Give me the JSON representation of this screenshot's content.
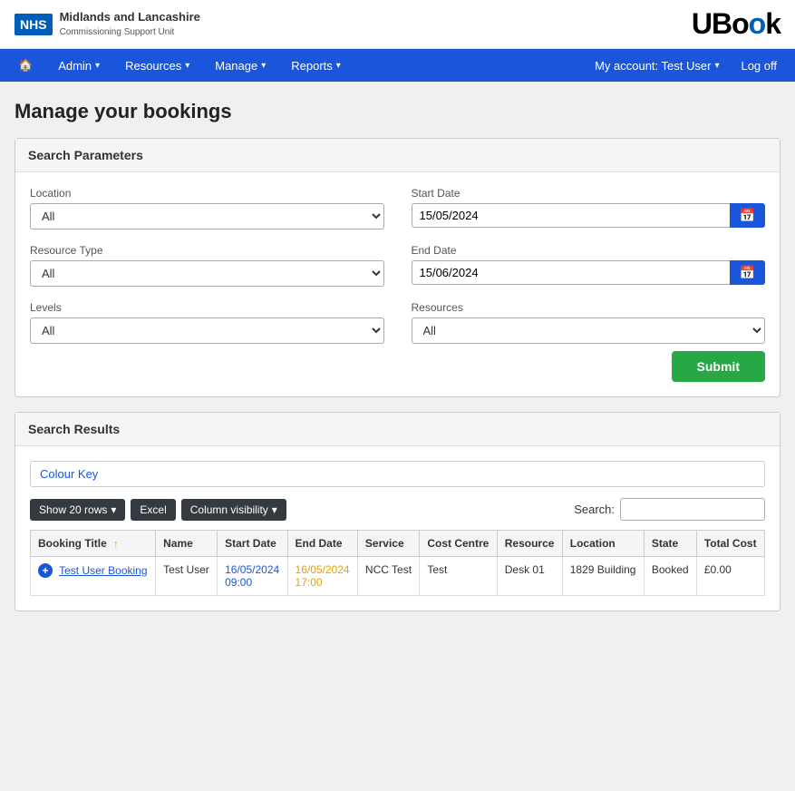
{
  "header": {
    "nhs_badge": "NHS",
    "org_name": "Midlands and Lancashire",
    "org_sub": "Commissioning Support Unit",
    "logo": "UBook"
  },
  "navbar": {
    "home_label": "🏠",
    "items": [
      {
        "label": "Admin",
        "has_dropdown": true
      },
      {
        "label": "Resources",
        "has_dropdown": true
      },
      {
        "label": "Manage",
        "has_dropdown": true
      },
      {
        "label": "Reports",
        "has_dropdown": true
      }
    ],
    "my_account_label": "My account: Test User",
    "logoff_label": "Log off"
  },
  "page": {
    "title": "Manage your bookings"
  },
  "search_params": {
    "panel_title": "Search Parameters",
    "location_label": "Location",
    "location_value": "All",
    "location_options": [
      "All"
    ],
    "resource_type_label": "Resource Type",
    "resource_type_value": "All",
    "resource_type_options": [
      "All"
    ],
    "levels_label": "Levels",
    "levels_value": "All",
    "levels_options": [
      "All"
    ],
    "start_date_label": "Start Date",
    "start_date_value": "15/05/2024",
    "end_date_label": "End Date",
    "end_date_value": "15/06/2024",
    "resources_label": "Resources",
    "resources_value": "All",
    "resources_options": [
      "All"
    ],
    "submit_label": "Submit"
  },
  "search_results": {
    "panel_title": "Search Results",
    "colour_key_label": "Colour Key",
    "show_rows_label": "Show 20 rows",
    "excel_label": "Excel",
    "column_visibility_label": "Column visibility",
    "search_label": "Search:",
    "search_placeholder": "",
    "columns": [
      {
        "label": "Booking Title",
        "sortable": true
      },
      {
        "label": "Name"
      },
      {
        "label": "Start Date"
      },
      {
        "label": "End Date"
      },
      {
        "label": "Service"
      },
      {
        "label": "Cost Centre"
      },
      {
        "label": "Resource"
      },
      {
        "label": "Location"
      },
      {
        "label": "State"
      },
      {
        "label": "Total Cost"
      }
    ],
    "rows": [
      {
        "booking_title": "Test User Booking",
        "name": "Test User",
        "start_date": "16/05/2024",
        "start_time": "09:00",
        "end_date": "16/05/2024",
        "end_time": "17:00",
        "service": "NCC Test",
        "cost_centre": "Test",
        "resource": "Desk 01",
        "location": "1829 Building",
        "state": "Booked",
        "total_cost": "£0.00"
      }
    ]
  }
}
